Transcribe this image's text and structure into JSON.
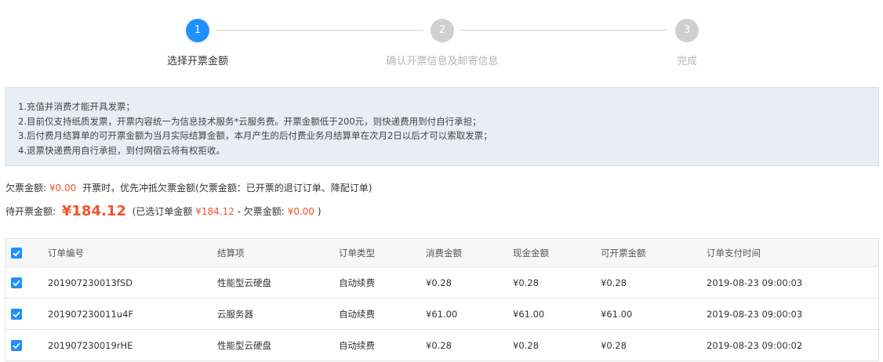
{
  "steps": [
    {
      "number": "1",
      "label": "选择开票金额"
    },
    {
      "number": "2",
      "label": "确认开票信息及邮寄信息"
    },
    {
      "number": "3",
      "label": "完成"
    }
  ],
  "notice": [
    "1.充值并消费才能开具发票；",
    "2.目前仅支持纸质发票，开票内容统一为信息技术服务*云服务费。开票金额低于200元，则快递费用到付自行承担；",
    "3.后付费月结算单的可开票金额为当月实际结算金额，本月产生的后付费业务月结算单在次月2日以后才可以索取发票；",
    "4.退票快递费用自行承担，到付网宿云将有权拒收。"
  ],
  "owed": {
    "label": "欠票金额:",
    "amount": "¥0.00",
    "desc": "开票时，优先冲抵欠票金额(欠票金额：已开票的退订订单、降配订单)"
  },
  "pending": {
    "label": "待开票金额:",
    "amount": "¥184.12",
    "detail_prefix": "(已选订单金额",
    "selected_amount": "¥184.12",
    "minus_label": "- 欠票金额:",
    "owed_amount": "¥0.00",
    "close": ")"
  },
  "table": {
    "headers": [
      "订单编号",
      "结算项",
      "订单类型",
      "消费金额",
      "现金金额",
      "可开票金额",
      "订单支付时间"
    ],
    "rows": [
      [
        "201907230013fSD",
        "性能型云硬盘",
        "自动续费",
        "¥0.28",
        "¥0.28",
        "¥0.28",
        "2019-08-23 09:00:03"
      ],
      [
        "201907230011u4F",
        "云服务器",
        "自动续费",
        "¥61.00",
        "¥61.00",
        "¥61.00",
        "2019-08-23 09:00:03"
      ],
      [
        "201907230019rHE",
        "性能型云硬盘",
        "自动续费",
        "¥0.28",
        "¥0.28",
        "¥0.28",
        "2019-08-23 09:00:02"
      ]
    ]
  },
  "colors": {
    "accent": "#1e90ff",
    "highlight": "#f0532a",
    "notice_bg": "#e9edf5"
  },
  "icons": {
    "checkbox": "checkbox-checked-icon"
  }
}
